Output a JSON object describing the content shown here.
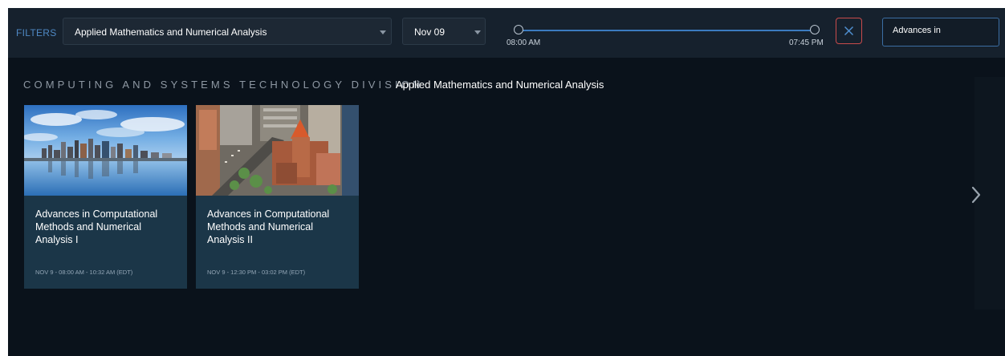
{
  "filter_bar": {
    "label": "FILTERS",
    "track_select": "Applied Mathematics and Numerical Analysis",
    "date_select": "Nov 09",
    "time_range": {
      "start": "08:00 AM",
      "end": "07:45 PM"
    },
    "search": {
      "value": "Advances in",
      "placeholder": ""
    }
  },
  "heading": {
    "division": "COMPUTING AND SYSTEMS TECHNOLOGY DIVISION",
    "track": "Applied Mathematics and Numerical Analysis"
  },
  "sessions": [
    {
      "title": "Advances in Computational Methods and Numerical Analysis I",
      "time": "NOV 9 - 08:00 AM - 10:32 AM (EDT)",
      "image": "boston-skyline-photo"
    },
    {
      "title": "Advances in Computational Methods and Numerical Analysis II",
      "time": "NOV 9 - 12:30 PM - 03:02 PM (EDT)",
      "image": "copley-square-aerial-photo"
    }
  ],
  "icons": {
    "clear": "close-icon",
    "next": "chevron-right-icon",
    "dropdown": "caret-down-icon"
  },
  "colors": {
    "accent": "#3b7bbf",
    "clear": "#c94b4b",
    "card": "#1b3648",
    "background": "#0a121b"
  }
}
